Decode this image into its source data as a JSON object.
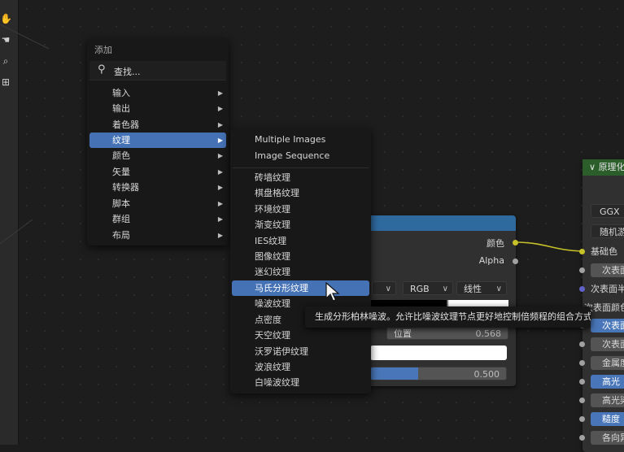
{
  "colors": {
    "menu_bg": "#181818",
    "highlight": "#4571b5",
    "node_header_blue": "#2f6a9e",
    "node_header_green": "#2b5e2b",
    "socket_yellow": "#c7c229",
    "socket_grey": "#a1a1a1",
    "socket_purple": "#6363c7"
  },
  "toolbar": {
    "icons": [
      "hand-icon",
      "camera-icon",
      "grid-icon"
    ]
  },
  "add_menu": {
    "title": "添加",
    "search_placeholder": "查找...",
    "items": [
      {
        "label": "输入"
      },
      {
        "label": "输出"
      },
      {
        "label": "着色器"
      },
      {
        "label": "纹理",
        "active": true
      },
      {
        "label": "颜色"
      },
      {
        "label": "矢量"
      },
      {
        "label": "转换器"
      },
      {
        "label": "脚本"
      },
      {
        "label": "群组"
      },
      {
        "label": "布局"
      }
    ]
  },
  "texture_submenu": {
    "top_items": [
      "Multiple Images",
      "Image Sequence"
    ],
    "items": [
      "砖墙纹理",
      "棋盘格纹理",
      "环境纹理",
      "渐变纹理",
      "IES纹理",
      "图像纹理",
      "迷幻纹理",
      "马氏分形纹理",
      "噪波纹理",
      "点密度",
      "天空纹理",
      "沃罗诺伊纹理",
      "波浪纹理",
      "白噪波纹理"
    ],
    "active_index": 7
  },
  "tooltip": {
    "text": "生成分形柏林噪波。允许比噪波纹理节点更好地控制倍频程的组合方式。"
  },
  "ramp_node": {
    "title": "",
    "outputs": [
      "颜色",
      "Alpha"
    ],
    "color_mode": "RGB",
    "interpolation": "线性",
    "pos_label": "位置",
    "pos_value": "0.568",
    "fac_value": "0.500"
  },
  "bsdf_node": {
    "title": "原理化",
    "rows": [
      "GGX",
      "随机游走",
      "基础色",
      "次表面",
      "次表面半",
      "次表面颜色",
      "次表面",
      "次表面",
      "金属度",
      "高光",
      "高光染",
      "糙度",
      "各向异"
    ]
  }
}
